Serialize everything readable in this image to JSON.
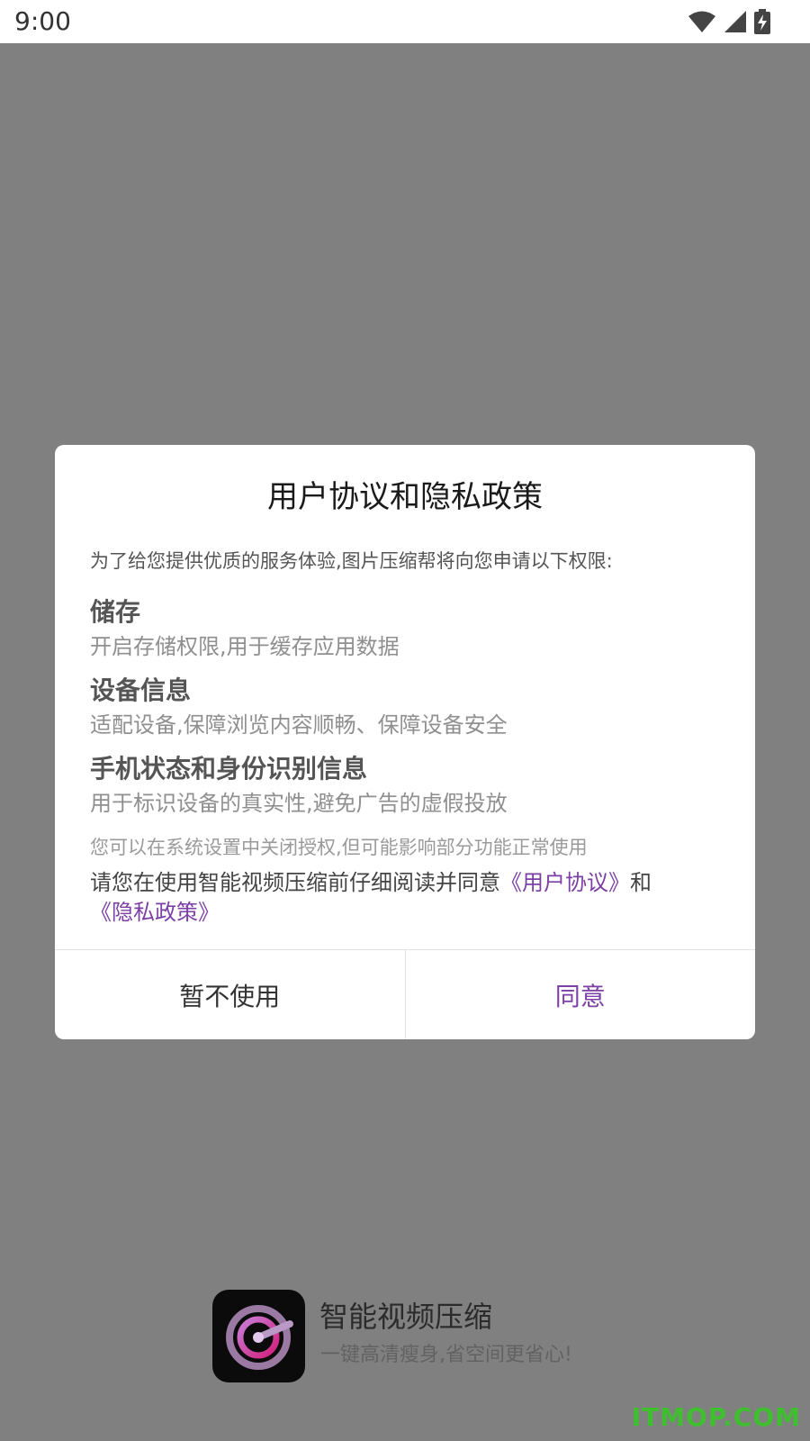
{
  "status_bar": {
    "time": "9:00",
    "icons": [
      "wifi-icon",
      "cell-signal-icon",
      "battery-charging-icon"
    ]
  },
  "dialog": {
    "title": "用户协议和隐私政策",
    "intro": "为了给您提供优质的服务体验,图片压缩帮将向您申请以下权限:",
    "permissions": [
      {
        "title": "储存",
        "desc": "开启存储权限,用于缓存应用数据"
      },
      {
        "title": "设备信息",
        "desc": "适配设备,保障浏览内容顺畅、保障设备安全"
      },
      {
        "title": "手机状态和身份识别信息",
        "desc": "用于标识设备的真实性,避免广告的虚假投放"
      }
    ],
    "note": "您可以在系统设置中关闭授权,但可能影响部分功能正常使用",
    "consent": {
      "prefix": "请您在使用智能视频压缩前仔细阅读并同意",
      "user_agreement": "《用户协议》",
      "and": "和",
      "privacy_policy": "《隐私政策》"
    },
    "buttons": {
      "decline": "暂不使用",
      "agree": "同意"
    }
  },
  "app": {
    "name": "智能视频压缩",
    "slogan": "一键高清瘦身,省空间更省心!"
  },
  "watermark": "ITMOP.COM",
  "colors": {
    "overlay": "#808080",
    "accent": "#7b3fa6",
    "watermark": "#3fbf2f"
  }
}
